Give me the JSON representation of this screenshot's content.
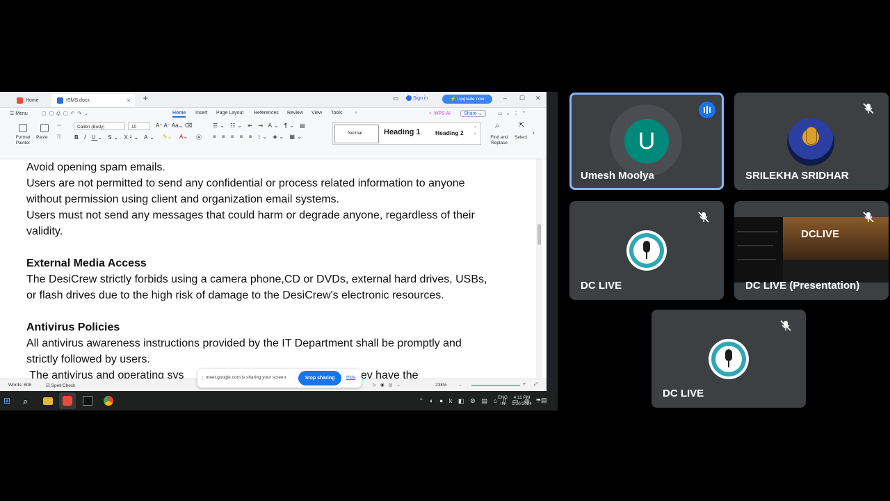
{
  "wps": {
    "tabs": [
      {
        "label": "Home"
      },
      {
        "label": "ISMS.docx"
      }
    ],
    "sign_in": "Sign in",
    "upgrade": "Upgrade now",
    "menu_label": "Menu",
    "menu_items": [
      "Home",
      "Insert",
      "Page Layout",
      "References",
      "Review",
      "View",
      "Tools"
    ],
    "wps_ai": "WPS AI",
    "share": "Share",
    "ribbon": {
      "format_painter": "Format Painter",
      "paste": "Paste",
      "font_name": "Calibri (Body)",
      "font_size": "10",
      "styles": [
        "Normal",
        "Heading 1",
        "Heading 2"
      ],
      "find_replace": "Find and Replace",
      "select": "Select"
    },
    "document": {
      "lines": [
        "Avoid opening spam emails.",
        "Users are not permitted to send any confidential or process related information to anyone",
        "without permission using client and organization email systems.",
        "Users must not send any messages that could harm or degrade anyone, regardless of their",
        "validity.",
        "",
        "External Media Access",
        "The DesiCrew strictly forbids using a camera phone,CD or DVDs, external hard drives, USBs,",
        "or flash drives due to the high risk of damage to the DesiCrew's electronic resources.",
        "",
        "Antivirus Policies",
        "All antivirus awareness instructions provided by the IT Department shall be promptly and",
        "strictly followed by users.",
        " The antivirus and operating sys                                cked to see if they have the"
      ],
      "headings": [
        "External Media Access",
        "Antivirus Policies"
      ]
    },
    "status": {
      "words": "Words: 608",
      "spell_check": "Spell Check",
      "zoom": "238%"
    },
    "share_banner": {
      "text": "meet.google.com is sharing your screen.",
      "stop": "Stop sharing",
      "hide": "Hide"
    },
    "taskbar": {
      "lang_top": "ENG",
      "lang_bottom": "IN",
      "time": "4:11 PM",
      "date": "1/30/2024"
    }
  },
  "meet": {
    "tiles": [
      {
        "name": "Umesh Moolya",
        "initial": "U",
        "speaking": true
      },
      {
        "name": "SRILEKHA SRIDHAR",
        "muted": true
      },
      {
        "name": "DC LIVE",
        "muted": true
      },
      {
        "name": "DC LIVE (Presentation)",
        "muted": true,
        "preview_title": "DCLIVE"
      },
      {
        "name": "DC LIVE",
        "muted": true
      }
    ]
  },
  "colors": {
    "avatar_teal": "#00897b",
    "meet_tile": "#3c4043",
    "speaking_border": "#8ab4f8",
    "wps_blue": "#2b6cd9",
    "stop_button": "#1a73e8"
  }
}
